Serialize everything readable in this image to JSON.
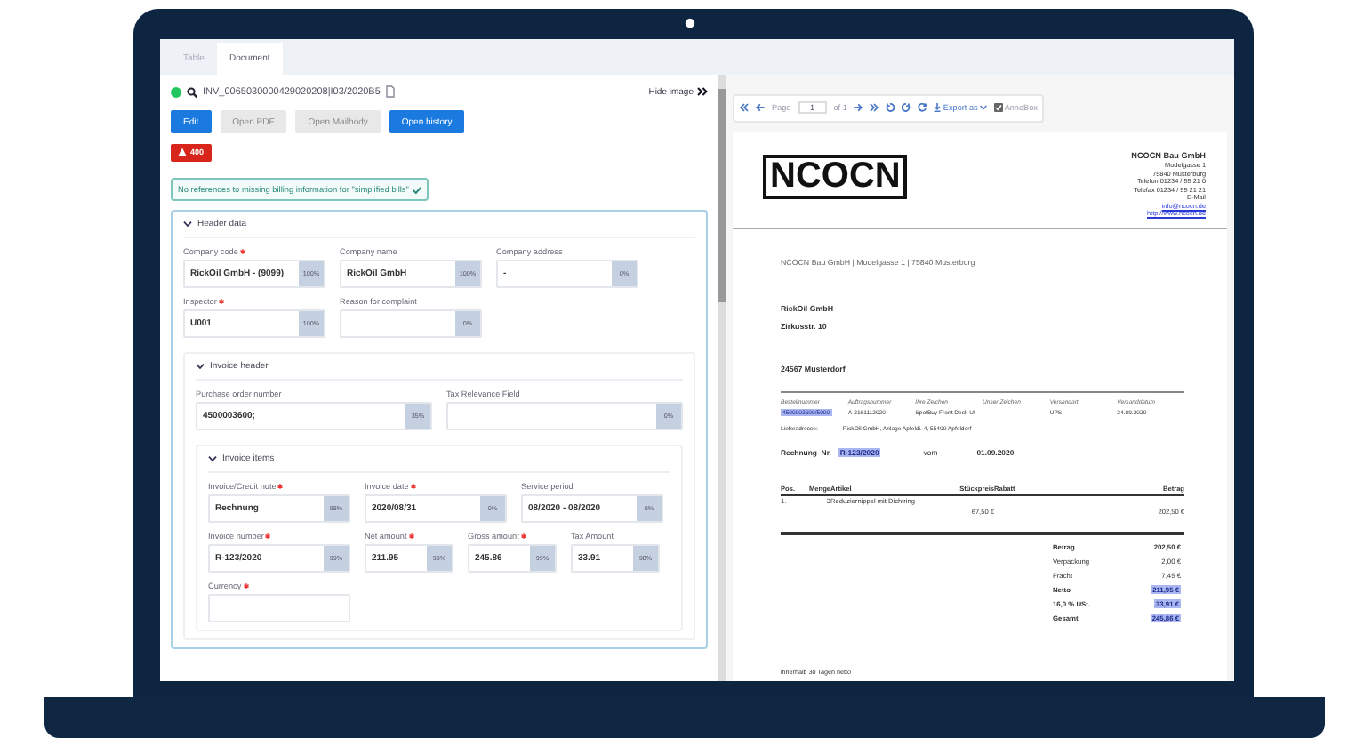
{
  "tabs": [
    {
      "label": "Table",
      "selected": false
    },
    {
      "label": "Document",
      "selected": true
    }
  ],
  "document": {
    "file_name": "INV_0065030000429020208|I03/2020B5",
    "hide_image": "Hide image"
  },
  "buttons": [
    {
      "label": "Edit",
      "disabled": false
    },
    {
      "label": "Open PDF",
      "disabled": true
    },
    {
      "label": "Open Mailbody",
      "disabled": true
    },
    {
      "label": "Open history",
      "disabled": false
    }
  ],
  "error_badge": "400",
  "notice": "No references to missing billing information for \"simplified bills\"",
  "sections": [
    {
      "title": "Header data",
      "expanded": true,
      "rows": [
        [
          {
            "label": "Company code",
            "required": true,
            "value": "RickOil GmbH - (9099)",
            "confidence": "100%"
          },
          {
            "label": "Company name",
            "required": false,
            "value": "RickOil GmbH",
            "confidence": "100%"
          },
          {
            "label": "Company address",
            "required": false,
            "value": "-",
            "confidence": "0%"
          }
        ],
        [
          {
            "label": "Inspector",
            "required": true,
            "value": "U001",
            "confidence": "100%"
          },
          {
            "label": "Reason for complaint",
            "required": false,
            "confidence": "0%"
          }
        ]
      ],
      "children": [
        {
          "title": "Invoice header",
          "expanded": true,
          "rows": [
            [
              {
                "label": "Purchase order number",
                "required": false,
                "value": "4500003600;",
                "confidence": "35%"
              },
              {
                "label": "Tax Relevance Field",
                "required": false,
                "confidence": "0%"
              }
            ]
          ],
          "children": [
            {
              "title": "Invoice items",
              "expanded": true,
              "rows": [
                [
                  {
                    "label": "Invoice/Credit note",
                    "required": true,
                    "value": "Rechnung",
                    "confidence": "98%"
                  },
                  {
                    "label": "Invoice date",
                    "required": true,
                    "value": "2020/08/31",
                    "confidence": "0%"
                  },
                  {
                    "label": "Service period",
                    "required": false,
                    "value": "08/2020 - 08/2020",
                    "confidence": "0%"
                  }
                ],
                [
                  {
                    "label": "Invoice number",
                    "required": true,
                    "value": "R-123/2020",
                    "confidence": "99%"
                  },
                  {
                    "label": "Net amount",
                    "required": true,
                    "value": "211.95",
                    "confidence": "99%"
                  },
                  {
                    "label": "Gross amount",
                    "required": true,
                    "value": "245.86",
                    "confidence": "99%"
                  },
                  {
                    "label": "Tax Amount",
                    "required": false,
                    "value": "33.91",
                    "confidence": "98%"
                  }
                ],
                [
                  {
                    "label": "Currency",
                    "required": true
                  }
                ]
              ]
            }
          ]
        }
      ]
    }
  ],
  "viewer": {
    "page_label": "Page",
    "page": "1",
    "page_of": "of 1",
    "export_label": "Export as",
    "annobox": {
      "label": "AnnoBox",
      "checked": true
    }
  },
  "invoice": {
    "logo": "NCOCN",
    "company": [
      {
        "text": "NCOCN Bau GmbH",
        "kind": "title"
      },
      {
        "text": "Modelgasse 1",
        "kind": "plain"
      },
      {
        "text": "75840 Musterburg",
        "kind": "plain"
      },
      {
        "text": "Telefon 01234 / 55 21 0",
        "kind": "plain"
      },
      {
        "text": "Telefax 01234 / 55 21 21",
        "kind": "plain"
      },
      {
        "text": "E-Mail",
        "kind": "plain"
      },
      {
        "text": "info@ncocn.de",
        "kind": "link"
      },
      {
        "text": "http://www.ncocn.de",
        "kind": "link"
      }
    ],
    "sender_line": "NCOCN Bau GmbH | Modelgasse 1 | 75840 Musterburg",
    "recipient": [
      "RickOil GmbH",
      "Zirkusstr. 10",
      "24567 Musterdorf"
    ],
    "info": [
      {
        "label": "Bestellnummer",
        "value": "4500003600/5000",
        "highlighted": true
      },
      {
        "label": "Auftragsnummer",
        "value": "A-2161112020",
        "highlighted": false
      },
      {
        "label": "Ihre Zeichen",
        "value": "SpotBuy Front Desk UI",
        "highlighted": false
      },
      {
        "label": "Unser Zeichen"
      },
      {
        "label": "Versandart",
        "value": "UPS",
        "highlighted": false
      },
      {
        "label": "Versanddatum",
        "value": "24.09.2020",
        "highlighted": false
      }
    ],
    "delivery": {
      "label": "Lieferadresse:",
      "value": "RickOil GmbH, Anlage Apfeldi. 4, 55400 Apfeldorf"
    },
    "invoice_line": {
      "label": "Rechnung  Nr.",
      "number": "R-123/2020",
      "number_highlighted": true,
      "vom": "vom",
      "date": "01.09.2020"
    },
    "items": {
      "columns": [
        "Pos.",
        "Menge",
        "Artikel",
        "Stückpreis",
        "Rabatt",
        "Betrag"
      ],
      "rows": [
        [
          "1.",
          "3",
          "Reduziernippel mit Dichtring",
          "67,50 €",
          "",
          "202,50 €"
        ]
      ]
    },
    "totals": [
      {
        "label": "Betrag",
        "value": "202,50 €",
        "kind": "bold",
        "highlighted": false
      },
      {
        "label": "Verpackung",
        "value": "2,00 €",
        "kind": "plain",
        "highlighted": false
      },
      {
        "label": "Fracht",
        "value": "7,45 €",
        "kind": "plain",
        "highlighted": false
      },
      {
        "label": "Netto",
        "value": "211,95 €",
        "kind": "bold",
        "highlighted": true
      },
      {
        "label": "16,0 % USt.",
        "value": "33,91 €",
        "kind": "bold",
        "highlighted": true
      },
      {
        "label": "Gesamt",
        "value": "245,86 €",
        "kind": "bold",
        "highlighted": true
      }
    ],
    "footer": "innerhalb 30 Tagen netto"
  }
}
